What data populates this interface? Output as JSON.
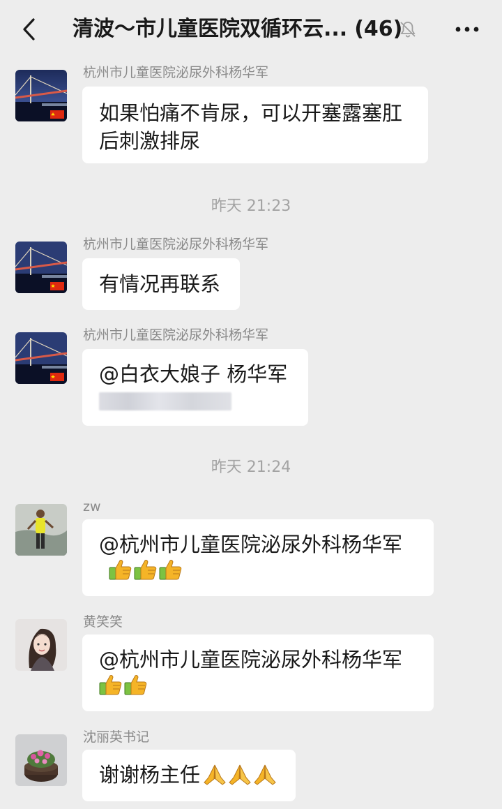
{
  "header": {
    "title": "清波～市儿童医院双循环云...",
    "member_count": "(46)",
    "back_icon": "chevron-left-icon",
    "mute_icon": "bell-off-icon",
    "more_icon": "more-horizontal-icon"
  },
  "messages": [
    {
      "sender": "杭州市儿童医院泌尿外科杨华军",
      "lines": [
        "如果怕痛不肯尿，可以开塞露塞肛",
        "后刺激排尿"
      ]
    },
    {
      "timestamp": "昨天 21:23"
    },
    {
      "sender": "杭州市儿童医院泌尿外科杨华军",
      "text": "有情况再联系"
    },
    {
      "sender": "杭州市儿童医院泌尿外科杨华军",
      "text": "@白衣大娘子 杨华军"
    },
    {
      "timestamp": "昨天 21:24"
    },
    {
      "sender": "zw",
      "text": "@杭州市儿童医院泌尿外科杨华军",
      "emoji": "thumbs-up-icon",
      "emoji_count": 3
    },
    {
      "sender": "黄笑笑",
      "text": "@杭州市儿童医院泌尿外科杨华军",
      "emoji": "thumbs-up-icon",
      "emoji_count": 2
    },
    {
      "sender": "沈丽英书记",
      "text": "谢谢杨主任",
      "emoji": "praying-hands-icon",
      "emoji_count": 3
    }
  ],
  "colors": {
    "background": "#ededed",
    "bubble": "#ffffff",
    "sender_text": "#8a8a8a",
    "timestamp_text": "#a3a3a3",
    "emoji_yellow": "#f5b427",
    "emoji_green": "#7cc242"
  }
}
